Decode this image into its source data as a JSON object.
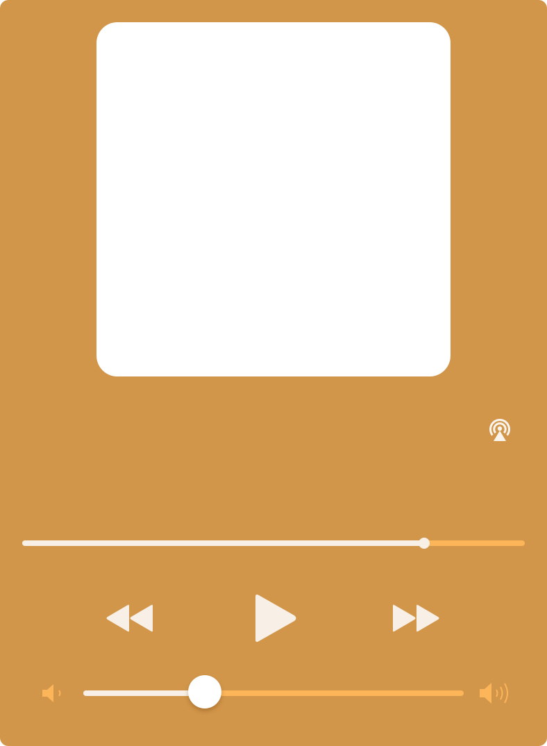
{
  "theme": {
    "background": "#D2964A",
    "artwork_color": "#FFFFFF",
    "control_color": "#F8EFE6",
    "accent": "#FDB55A",
    "icon_light": "#FBF4EC"
  },
  "artwork": {
    "icon": "album-artwork"
  },
  "airplay": {
    "icon": "airplay-icon"
  },
  "playback": {
    "progress": 0.8
  },
  "transport": {
    "rewind_icon": "rewind-icon",
    "play_icon": "play-icon",
    "fast_forward_icon": "fast-forward-icon"
  },
  "volume": {
    "level": 0.32,
    "low_icon": "volume-low-icon",
    "high_icon": "volume-high-icon"
  }
}
